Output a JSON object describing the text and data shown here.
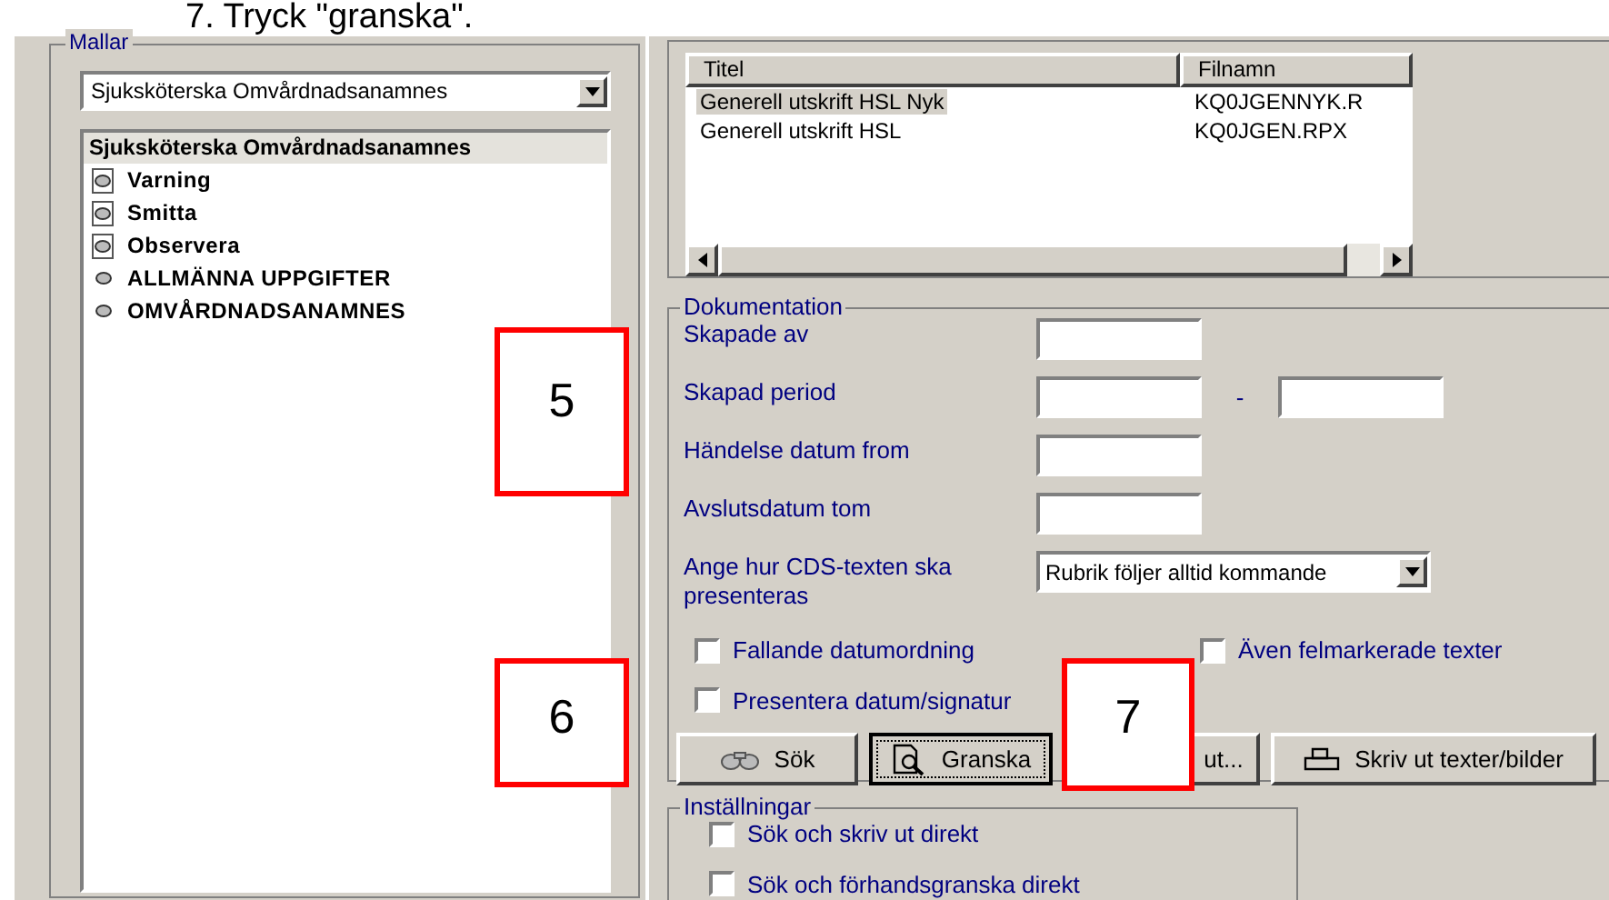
{
  "heading": "7.  Tryck \"granska\".",
  "templates": {
    "legend": "Mallar",
    "dropdown": {
      "value": "Sjuksköterska Omvårdnadsanamnes"
    },
    "tree": {
      "title": "Sjuksköterska Omvårdnadsanamnes",
      "items": [
        {
          "label": "Varning",
          "kind": "note"
        },
        {
          "label": "Smitta",
          "kind": "note"
        },
        {
          "label": "Observera",
          "kind": "note"
        },
        {
          "label": "ALLMÄNNA UPPGIFTER",
          "kind": "section"
        },
        {
          "label": "OMVÅRDNADSANAMNES",
          "kind": "section"
        }
      ]
    }
  },
  "reports": {
    "columns": [
      "Titel",
      "Filnamn"
    ],
    "rows": [
      {
        "title": "Generell utskrift HSL Nyk",
        "file": "KQ0JGENNYK.R",
        "selected": true
      },
      {
        "title": "Generell utskrift HSL",
        "file": "KQ0JGEN.RPX",
        "selected": false
      }
    ]
  },
  "documentation": {
    "legend": "Dokumentation",
    "fields": [
      {
        "label": "Skapade av",
        "kind": "single"
      },
      {
        "label": "Skapad period",
        "kind": "range",
        "separator": "-"
      },
      {
        "label": "Händelse datum from",
        "kind": "single"
      },
      {
        "label": "Avslutsdatum tom",
        "kind": "single"
      },
      {
        "label": "Ange hur CDS-texten ska presenteras",
        "kind": "select",
        "value": "Rubrik följer alltid kommande"
      }
    ],
    "checkboxes": [
      {
        "label": "Fallande datumordning",
        "checked": false
      },
      {
        "label": "Även felmarkerade texter",
        "checked": false
      },
      {
        "label": "Presentera datum/signatur",
        "checked": false
      }
    ],
    "buttons": [
      {
        "label": "Sök",
        "kind": "binoculars",
        "focused": false
      },
      {
        "label": "Granska",
        "kind": "preview",
        "focused": true
      },
      {
        "label": "ut...",
        "kind": "plain",
        "focused": false
      },
      {
        "label": "Skriv ut texter/bilder",
        "kind": "printer",
        "focused": false
      }
    ]
  },
  "settings": {
    "legend": "Inställningar",
    "checkboxes": [
      {
        "label": "Sök och skriv ut direkt",
        "checked": false
      },
      {
        "label": "Sök och förhandsgranska direkt",
        "checked": false
      }
    ]
  },
  "callouts": [
    {
      "number": "5"
    },
    {
      "number": "6"
    },
    {
      "number": "7"
    }
  ]
}
